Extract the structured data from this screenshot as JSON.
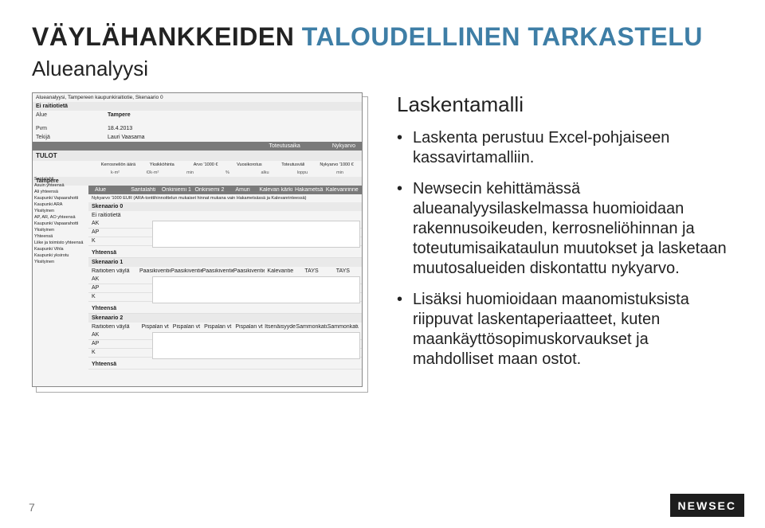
{
  "title": {
    "part1": "VÄYLÄHANKKEIDEN ",
    "part2": "TALOUDELLINEN TARKASTELU"
  },
  "subtitle": "Alueanalyysi",
  "right": {
    "heading": "Laskentamalli",
    "bullets": [
      "Laskenta perustuu Excel-pohjaiseen kassavirtamalliin.",
      "Newsecin kehittämässä alueanalyysilaskelmassa huomioidaan rakennusoikeuden, kerrosneliöhinnan ja toteutumisaikataulun muutokset ja lasketaan muutosalueiden diskontattu nykyarvo.",
      "Lisäksi huomioidaan maanomistuksista riippuvat laskentaperiaatteet, kuten maankäyttösopimuskorvaukset ja mahdolliset maan ostot."
    ]
  },
  "shot": {
    "headerSmall": "Alueanalyysi, Tampereen kaupunkiraitiotie, Skenaario 0",
    "ei_raitio": "Ei raitiotietä",
    "alue_label": "Alue",
    "alue_value": "Tampere",
    "pvm_label": "Pvm",
    "pvm_value": "18.4.2013",
    "tekija_label": "Tekijä",
    "tekija_value": "Lauri Vaasama",
    "timebar_left": "Toteutusaika",
    "timebar_right": "Nykyarvo",
    "tulot": "TULOT",
    "tulot_cols": [
      "Kerrosneliön äärä",
      "Yksikköhinta",
      "Arvo '1000 €",
      "Vuosikorotus",
      "Toteutusväli",
      "Nykyarvo '1000 €"
    ],
    "tulot_units": [
      "k-m²",
      "€/k-m²",
      "min",
      "%",
      "alku",
      "loppu",
      "min"
    ],
    "tampere": "Tampere",
    "areas_header_label": "Alue",
    "areas_header_cols": [
      "Santalahti",
      "Onkiniemi 1",
      "Onkiniemi 2",
      "Amuri",
      "Kalevan kärki",
      "Hakametsä",
      "Kalevanrinne"
    ],
    "footnote": "Nykyarvo '1000 EUR (ARA-tonttihinnoittelun mukaiset hinnat mukana vain Hakametsässä ja Kalevanrinteessä)",
    "scen0": "Skenaario 0",
    "scen0_sub": "Ei raitiotietä",
    "rowlabels0": [
      "AK",
      "AP",
      "K",
      "Yhteensä"
    ],
    "scen1": "Skenaario 1",
    "scen1_sub": "Raitiotien väylä",
    "scen1_cols": [
      "Paasikiventie",
      "Paasikiventie",
      "Paasikiventie",
      "Paasikiventie",
      "Kalevantie",
      "TAYS",
      "TAYS"
    ],
    "rowlabels1": [
      "AK",
      "AP",
      "K",
      "Yhteensä"
    ],
    "scen2": "Skenaario 2",
    "scen2_sub": "Raitiotien väylä",
    "scen2_cols": [
      "Pispalan vt",
      "Pispalan vt",
      "Pispalan vt",
      "Pispalan vt",
      "Itsenäisyydenkatu",
      "Sammonkatu",
      "Sammonkatu"
    ],
    "rowlabels2": [
      "AK",
      "AP",
      "K",
      "Yhteensä"
    ],
    "sidebar": [
      "Santalahti",
      "Asuin yhteensä",
      "Ali yhteensä",
      "Kaupunki Vapaarahotti",
      "Kaupunki ARA",
      "Yksityinen",
      "AP, AR, AO yhteensä",
      "Kaupunki Vapaarahotti",
      "Yksityinen",
      "Yhteensä",
      "Liike ja toimisto yhteensä",
      "Kaupunki Vihla",
      "Kaupunki yksirotu",
      "Yksityinen"
    ]
  },
  "pagenum": "7",
  "logo": "NEWSEC"
}
